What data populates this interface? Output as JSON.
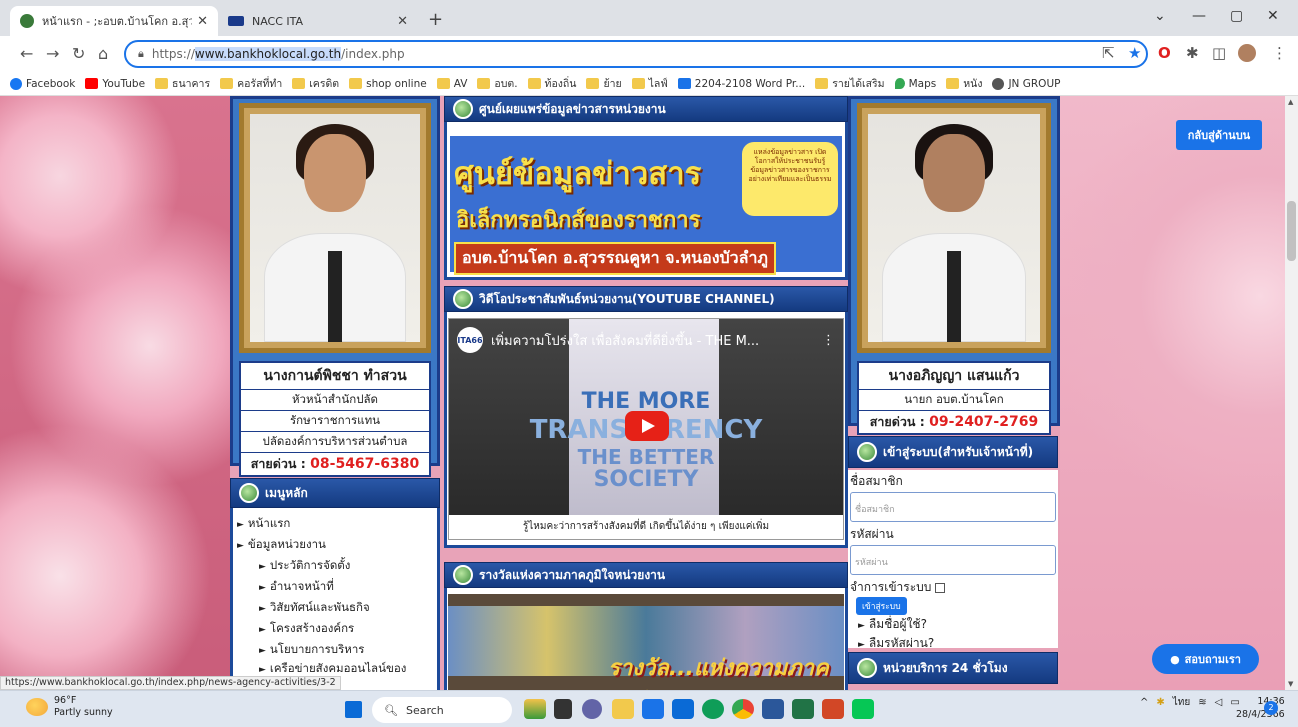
{
  "browser": {
    "tabs": [
      {
        "label": "หน้าแรก - ;ะอบต.บ้านโคก อ.สุวรรณคูห",
        "color": "#3a7a3a"
      },
      {
        "label": "NACC ITA",
        "color": "#1a3a8a"
      }
    ],
    "url_prefix": "https://",
    "url_host": "www.bankhoklocal.go.th",
    "url_path": "/index.php",
    "bookmarks": [
      {
        "label": "Facebook",
        "icon": "facebook-icon",
        "color": "#1877f2"
      },
      {
        "label": "YouTube",
        "icon": "youtube-icon",
        "color": "#ff0000"
      },
      {
        "label": "ธนาคาร",
        "icon": "folder-icon"
      },
      {
        "label": "คอรัสที่ทำ",
        "icon": "folder-icon"
      },
      {
        "label": "เครดิต",
        "icon": "folder-icon"
      },
      {
        "label": "shop online",
        "icon": "folder-icon"
      },
      {
        "label": "AV",
        "icon": "folder-icon"
      },
      {
        "label": "อบต.",
        "icon": "folder-icon"
      },
      {
        "label": "ท้องถิ่น",
        "icon": "folder-icon"
      },
      {
        "label": "ย้าย",
        "icon": "folder-icon"
      },
      {
        "label": "ไลฟ์",
        "icon": "folder-icon"
      },
      {
        "label": "2204-2108 Word Pr...",
        "icon": "calendar-icon",
        "color": "#1a73e8"
      },
      {
        "label": "รายได้เสริม",
        "icon": "folder-icon"
      },
      {
        "label": "Maps",
        "icon": "maps-icon",
        "color": "#34a853"
      },
      {
        "label": "หนัง",
        "icon": "folder-icon"
      },
      {
        "label": "JN GROUP",
        "icon": "globe-icon",
        "color": "#555"
      }
    ]
  },
  "left_profile": {
    "name": "นางกานต์พิชชา ทำสวน",
    "lines": [
      "หัวหน้าสำนักปลัด",
      "รักษาราชการแทน",
      "ปลัดองค์การบริหารส่วนตำบล"
    ],
    "hotline_label": "สายด่วน :",
    "hotline": "08-5467-6380"
  },
  "right_profile": {
    "name": "นางอภิญญา แสนแก้ว",
    "lines": [
      "นายก อบต.บ้านโคก"
    ],
    "hotline_label": "สายด่วน :",
    "hotline": "09-2407-2769"
  },
  "menu": {
    "title": "เมนูหลัก",
    "items": [
      {
        "label": "หน้าแรก",
        "sub": false
      },
      {
        "label": "ข้อมูลหน่วยงาน",
        "sub": false
      },
      {
        "label": "ประวัติการจัดตั้ง",
        "sub": true
      },
      {
        "label": "อำนาจหน้าที่",
        "sub": true
      },
      {
        "label": "วิสัยทัศน์และพันธกิจ",
        "sub": true
      },
      {
        "label": "โครงสร้างองค์กร",
        "sub": true
      },
      {
        "label": "นโยบายการบริหาร",
        "sub": true
      },
      {
        "label": "เครือข่ายสังคมออนไลน์ของหน่วยงาน",
        "sub": true
      }
    ]
  },
  "center": {
    "info_header": "ศูนย์เผยแพร่ข้อมูลข่าวสารหน่วยงาน",
    "banner": {
      "line1": "ศูนย์ข้อมูลข่าวสาร",
      "line2": "อิเล็กทรอนิกส์ของราชการ",
      "line3": "อบต.บ้านโคก อ.สุวรรณคูหา จ.หนองบัวลำภู",
      "bubble": "แหล่งข้อมูลข่าวสาร เปิดโอกาสให้ประชาชนรับรู้ ข้อมูลข่าวสารของราชการ อย่างเท่าเทียมและเป็นธรรม"
    },
    "video_header": "วิดีโอประชาสัมพันธ์หน่วยงาน(YOUTUBE CHANNEL)",
    "video": {
      "channel": "ITA66",
      "title": "เพิ่มความโปร่งใส เพื่อสังคมที่ดียิ่งขึ้น - THE M...",
      "big1": "THE MORE",
      "big2": "TRANSPARENCY",
      "big3": "THE BETTER",
      "big4": "SOCIETY",
      "caption": "รู้ไหมคะว่าการสร้างสังคมที่ดี เกิดขึ้นได้ง่าย ๆ เพียงแค่เพิ่ม"
    },
    "award_header": "รางวัลแห่งความภาคภูมิใจหน่วยงาน",
    "award_text": "รางวัล...แห่งความภาคภูมิใจ"
  },
  "login": {
    "title": "เข้าสู่ระบบ(สำหรับเจ้าหน้าที่)",
    "username_label": "ชื่อสมาชิก",
    "username_placeholder": "ชื่อสมาชิก",
    "password_label": "รหัสผ่าน",
    "password_placeholder": "รหัสผ่าน",
    "remember_label": "จำการเข้าระบบ",
    "submit": "เข้าสู่ระบบ",
    "forgot_user": "ลืมชื่อผู้ใช้?",
    "forgot_pass": "ลืมรหัสผ่าน?"
  },
  "service": {
    "title": "หน่วยบริการ 24 ชั่วโมง"
  },
  "back_to_top": "กลับสู่ด้านบน",
  "ask_us": "สอบถามเรา",
  "status_url": "https://www.bankhoklocal.go.th/index.php/news-agency-activities/3-2",
  "taskbar": {
    "temp": "96°F",
    "weather": "Partly sunny",
    "search": "Search",
    "lang": "ไทย",
    "time": "14:36",
    "date": "28/4/2566",
    "notif_count": "2"
  }
}
